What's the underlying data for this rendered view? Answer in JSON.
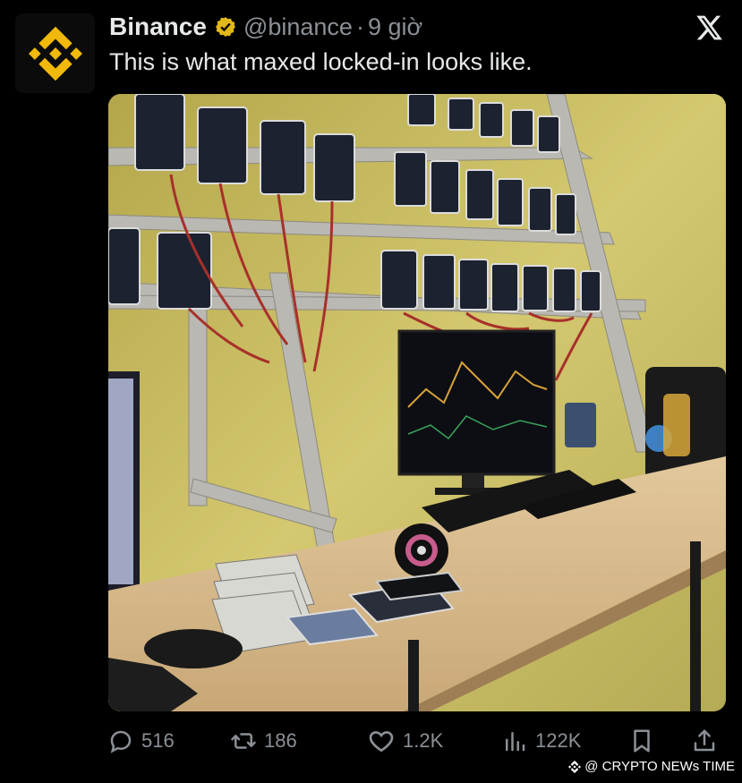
{
  "tweet": {
    "author_name": "Binance",
    "handle": "@binance",
    "separator": "·",
    "time": "9 giờ",
    "text": "This is what maxed locked-in looks like."
  },
  "icons": {
    "avatar": "binance-logo-icon",
    "verified": "verified-badge-icon",
    "platform": "x-logo-icon"
  },
  "media": {
    "description_hidden": ""
  },
  "actions": {
    "reply_count": "516",
    "retweet_count": "186",
    "like_count": "1.2K",
    "views_count": "122K"
  },
  "watermark": {
    "text": "@ CRYPTO NEWs TIME"
  },
  "colors": {
    "background": "#000000",
    "binance_yellow": "#F0B90B",
    "text_primary": "#E7E9EA",
    "text_secondary": "#8B9096"
  }
}
